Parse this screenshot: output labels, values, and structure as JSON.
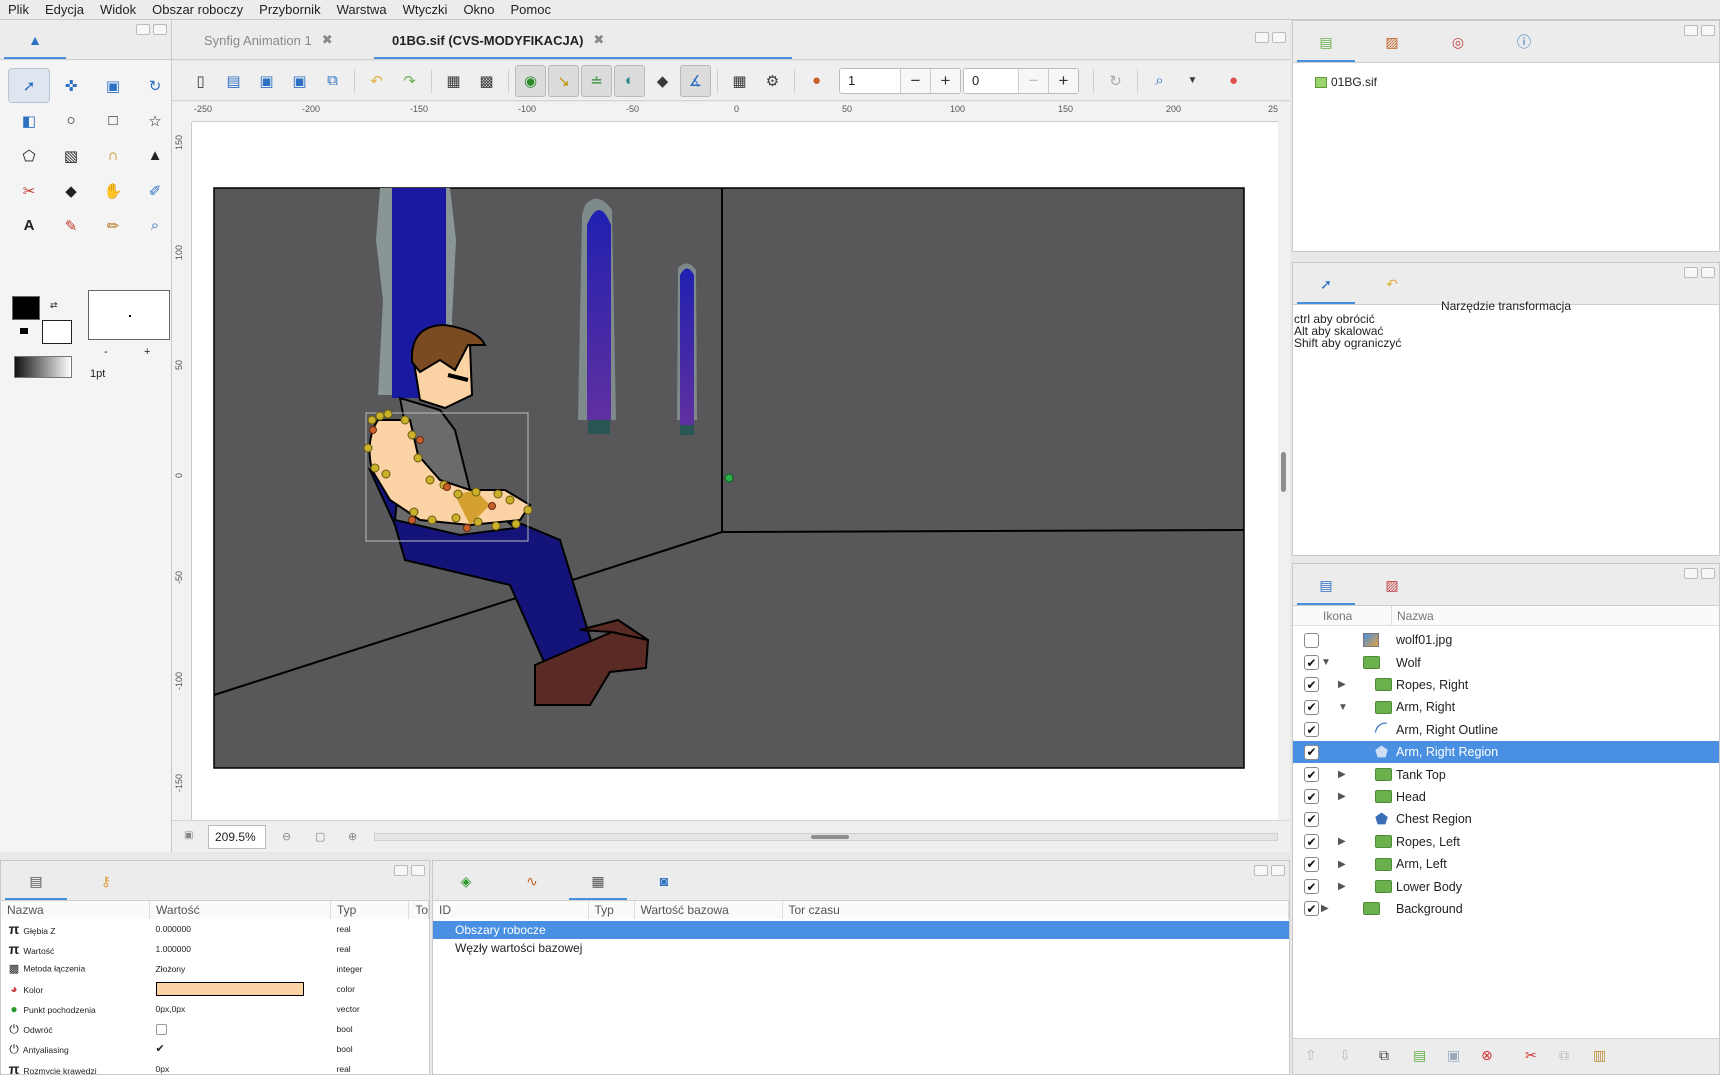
{
  "menu": [
    "Plik",
    "Edycja",
    "Widok",
    "Obszar roboczy",
    "Przybornik",
    "Warstwa",
    "Wtyczki",
    "Okno",
    "Pomoc"
  ],
  "documents": {
    "tabs": [
      {
        "label": "Synfig Animation 1",
        "active": false
      },
      {
        "label": "01BG.sif (CVS-MODYFIKACJA)",
        "active": true
      }
    ]
  },
  "toolbar": {
    "spin1_value": "1",
    "spin2_value": "0",
    "minus": "−",
    "plus": "+"
  },
  "rulers": {
    "top": [
      "-250",
      "-200",
      "-150",
      "-100",
      "-50",
      "0",
      "50",
      "100",
      "150",
      "200",
      "25"
    ],
    "left": [
      "150",
      "100",
      "50",
      "0",
      "-50",
      "-100",
      "-150"
    ]
  },
  "status": {
    "zoom": "209.5%"
  },
  "toolbox": {
    "brush_size": "1pt",
    "minus": "-",
    "plus": "+"
  },
  "canvas_browser": {
    "file": "01BG.sif"
  },
  "tool_options": {
    "title": "Narzędzie transformacja",
    "hints": [
      "ctrl aby obrócić",
      "Alt aby skalować",
      "Shift aby ograniczyć"
    ]
  },
  "params": {
    "headers": [
      "Nazwa",
      "Wartość",
      "Typ",
      "To"
    ],
    "rows": [
      {
        "name": "Głębia Z",
        "value": "0.000000",
        "type": "real",
        "icon": "pi-icon"
      },
      {
        "name": "Wartość",
        "value": "1.000000",
        "type": "real",
        "icon": "pi-icon"
      },
      {
        "name": "Metoda łączenia",
        "value": "Złożony",
        "type": "integer",
        "icon": "blend-icon"
      },
      {
        "name": "Kolor",
        "value": "",
        "type": "color",
        "icon": "color-icon",
        "swatch": "#fbd3a4"
      },
      {
        "name": "Punkt pochodzenia",
        "value": "0px,0px",
        "type": "vector",
        "icon": "vector-icon"
      },
      {
        "name": "Odwróć",
        "value": "",
        "type": "bool",
        "icon": "power-icon",
        "checked": false
      },
      {
        "name": "Antyaliasing",
        "value": "",
        "type": "bool",
        "icon": "power-icon",
        "checked": true
      },
      {
        "name": "Rozmycie krawędzi",
        "value": "0px",
        "type": "real",
        "icon": "pi-icon"
      }
    ]
  },
  "library": {
    "headers": [
      "ID",
      "Typ",
      "Wartość bazowa",
      "Tor czasu"
    ],
    "rows": [
      {
        "label": "Obszary robocze",
        "selected": true
      },
      {
        "label": "Węzły wartości bazowej",
        "selected": false
      }
    ]
  },
  "layers": {
    "headers": [
      "Ikona",
      "Nazwa"
    ],
    "rows": [
      {
        "name": "wolf01.jpg",
        "checked": false,
        "depth": 0,
        "expander": "",
        "kind": "image"
      },
      {
        "name": "Wolf",
        "checked": true,
        "depth": 0,
        "expander": "open",
        "kind": "folder"
      },
      {
        "name": "Ropes, Right",
        "checked": true,
        "depth": 1,
        "expander": "closed",
        "kind": "folder"
      },
      {
        "name": "Arm, Right",
        "checked": true,
        "depth": 1,
        "expander": "open",
        "kind": "folder"
      },
      {
        "name": "Arm, Right Outline",
        "checked": true,
        "depth": 2,
        "expander": "",
        "kind": "outline"
      },
      {
        "name": "Arm, Right Region",
        "checked": true,
        "depth": 2,
        "expander": "",
        "kind": "region",
        "selected": true
      },
      {
        "name": "Tank Top",
        "checked": true,
        "depth": 1,
        "expander": "closed",
        "kind": "folder"
      },
      {
        "name": "Head",
        "checked": true,
        "depth": 1,
        "expander": "closed",
        "kind": "folder"
      },
      {
        "name": "Chest Region",
        "checked": true,
        "depth": 1,
        "expander": "",
        "kind": "region"
      },
      {
        "name": "Ropes, Left",
        "checked": true,
        "depth": 1,
        "expander": "closed",
        "kind": "folder"
      },
      {
        "name": "Arm, Left",
        "checked": true,
        "depth": 1,
        "expander": "closed",
        "kind": "folder"
      },
      {
        "name": "Lower Body",
        "checked": true,
        "depth": 1,
        "expander": "closed",
        "kind": "folder"
      },
      {
        "name": "Background",
        "checked": true,
        "depth": 0,
        "expander": "closed",
        "kind": "folder"
      }
    ]
  },
  "colors": {
    "accent": "#4a90e2",
    "scene_bg": "#58585a",
    "column_blue": "#1a1aa0",
    "skin": "#fbd3a4",
    "jeans": "#13137a",
    "shoes": "#5a2a24",
    "handle": "#c9b22a"
  }
}
